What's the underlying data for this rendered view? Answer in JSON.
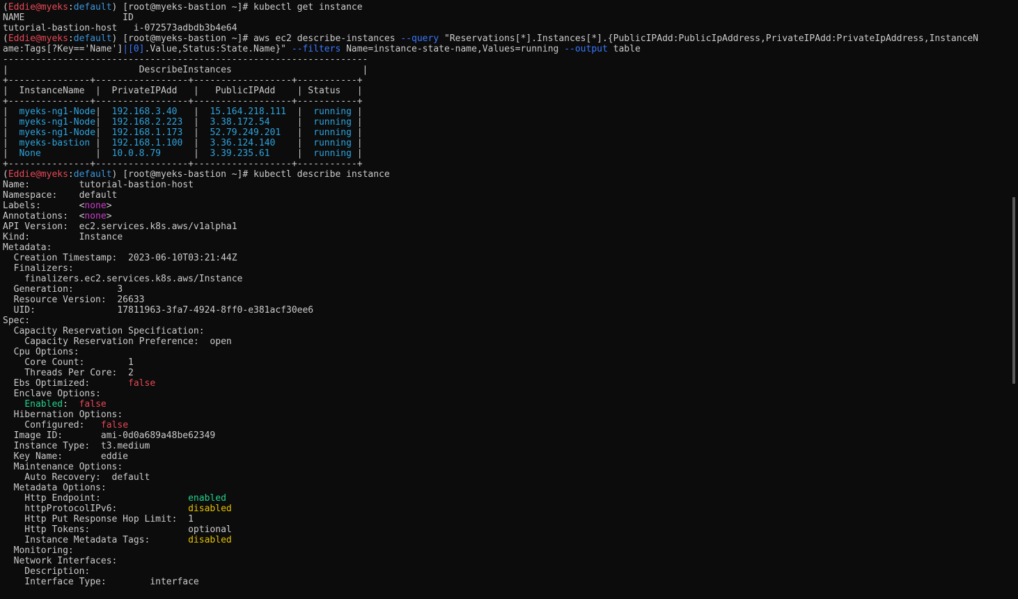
{
  "colors": {
    "background": "#0c0c0c",
    "text": "#cccccc",
    "prompt_user": "#e74856",
    "prompt_context": "#3a96dd",
    "option": "#3b78ff",
    "table_value": "#2ea3dd",
    "none_value": "#c83cc8",
    "enabled_value": "#23d18b",
    "disabled_value": "#e5c100",
    "false_value": "#e74856"
  },
  "lines": [
    [
      [
        "(",
        "w"
      ],
      [
        "Eddie@myeks",
        "r"
      ],
      [
        ":",
        "w"
      ],
      [
        "default",
        "c"
      ],
      [
        ") [root@myeks-bastion ~]# kubectl get instance",
        "w"
      ]
    ],
    [
      [
        "NAME                  ID",
        "w"
      ]
    ],
    [
      [
        "tutorial-bastion-host   i-072573adbdb3b4e64",
        "w"
      ]
    ],
    [
      [
        "(",
        "w"
      ],
      [
        "Eddie@myeks",
        "r"
      ],
      [
        ":",
        "w"
      ],
      [
        "default",
        "c"
      ],
      [
        ") [root@myeks-bastion ~]# aws ec2 describe-instances ",
        "w"
      ],
      [
        "--query",
        "b"
      ],
      [
        " \"Reservations[*].Instances[*].{PublicIPAdd:PublicIpAddress,PrivateIPAdd:PrivateIpAddress,InstanceN",
        "w"
      ]
    ],
    [
      [
        "ame:Tags[?Key=='Name']",
        "w"
      ],
      [
        "|[0]",
        "b"
      ],
      [
        ".Value,Status:State.Name}\" ",
        "w"
      ],
      [
        "--filters",
        "b"
      ],
      [
        " Name=instance-state-name,Values=running ",
        "w"
      ],
      [
        "--output",
        "b"
      ],
      [
        " table",
        "w"
      ]
    ],
    [
      [
        "-------------------------------------------------------------------",
        "w"
      ]
    ],
    [
      [
        "|                        DescribeInstances                        |",
        "w"
      ]
    ],
    [
      [
        "+---------------+-----------------+------------------+-----------+",
        "w"
      ]
    ],
    [
      [
        "|  InstanceName  |  PrivateIPAdd   |   PublicIPAdd    | Status   |",
        "w"
      ]
    ],
    [
      [
        "+---------------+-----------------+------------------+-----------+",
        "w"
      ]
    ],
    [
      [
        "|  ",
        "w"
      ],
      [
        "myeks-ng1-Node",
        "t"
      ],
      [
        "|  ",
        "w"
      ],
      [
        "192.168.3.40",
        "t"
      ],
      [
        "   |  ",
        "w"
      ],
      [
        "15.164.218.111",
        "t"
      ],
      [
        "  |  ",
        "w"
      ],
      [
        "running",
        "t"
      ],
      [
        " |",
        "w"
      ]
    ],
    [
      [
        "|  ",
        "w"
      ],
      [
        "myeks-ng1-Node",
        "t"
      ],
      [
        "|  ",
        "w"
      ],
      [
        "192.168.2.223",
        "t"
      ],
      [
        "  |  ",
        "w"
      ],
      [
        "3.38.172.54",
        "t"
      ],
      [
        "     |  ",
        "w"
      ],
      [
        "running",
        "t"
      ],
      [
        " |",
        "w"
      ]
    ],
    [
      [
        "|  ",
        "w"
      ],
      [
        "myeks-ng1-Node",
        "t"
      ],
      [
        "|  ",
        "w"
      ],
      [
        "192.168.1.173",
        "t"
      ],
      [
        "  |  ",
        "w"
      ],
      [
        "52.79.249.201",
        "t"
      ],
      [
        "   |  ",
        "w"
      ],
      [
        "running",
        "t"
      ],
      [
        " |",
        "w"
      ]
    ],
    [
      [
        "|  ",
        "w"
      ],
      [
        "myeks-bastion",
        "t"
      ],
      [
        " |  ",
        "w"
      ],
      [
        "192.168.1.100",
        "t"
      ],
      [
        "  |  ",
        "w"
      ],
      [
        "3.36.124.140",
        "t"
      ],
      [
        "    |  ",
        "w"
      ],
      [
        "running",
        "t"
      ],
      [
        " |",
        "w"
      ]
    ],
    [
      [
        "|  ",
        "w"
      ],
      [
        "None",
        "t"
      ],
      [
        "          |  ",
        "w"
      ],
      [
        "10.0.8.79",
        "t"
      ],
      [
        "      |  ",
        "w"
      ],
      [
        "3.39.235.61",
        "t"
      ],
      [
        "     |  ",
        "w"
      ],
      [
        "running",
        "t"
      ],
      [
        " |",
        "w"
      ]
    ],
    [
      [
        "+---------------+-----------------+------------------+-----------+",
        "w"
      ]
    ],
    [
      [
        "(",
        "w"
      ],
      [
        "Eddie@myeks",
        "r"
      ],
      [
        ":",
        "w"
      ],
      [
        "default",
        "c"
      ],
      [
        ") [root@myeks-bastion ~]# kubectl describe instance",
        "w"
      ]
    ],
    [
      [
        "Name:         tutorial-bastion-host",
        "w"
      ]
    ],
    [
      [
        "Namespace:    default",
        "w"
      ]
    ],
    [
      [
        "Labels:       <",
        "w"
      ],
      [
        "none",
        "m"
      ],
      [
        ">",
        "w"
      ]
    ],
    [
      [
        "Annotations:  <",
        "w"
      ],
      [
        "none",
        "m"
      ],
      [
        ">",
        "w"
      ]
    ],
    [
      [
        "API Version:  ec2.services.k8s.aws/v1alpha1",
        "w"
      ]
    ],
    [
      [
        "Kind:         Instance",
        "w"
      ]
    ],
    [
      [
        "Metadata:",
        "w"
      ]
    ],
    [
      [
        "  Creation Timestamp:  2023-06-10T03:21:44Z",
        "w"
      ]
    ],
    [
      [
        "  Finalizers:",
        "w"
      ]
    ],
    [
      [
        "    finalizers.ec2.services.k8s.aws/Instance",
        "w"
      ]
    ],
    [
      [
        "  Generation:        3",
        "w"
      ]
    ],
    [
      [
        "  Resource Version:  26633",
        "w"
      ]
    ],
    [
      [
        "  UID:               17811963-3fa7-4924-8ff0-e381acf30ee6",
        "w"
      ]
    ],
    [
      [
        "Spec:",
        "w"
      ]
    ],
    [
      [
        "  Capacity Reservation Specification:",
        "w"
      ]
    ],
    [
      [
        "    Capacity Reservation Preference:  open",
        "w"
      ]
    ],
    [
      [
        "  Cpu Options:",
        "w"
      ]
    ],
    [
      [
        "    Core Count:        1",
        "w"
      ]
    ],
    [
      [
        "    Threads Per Core:  2",
        "w"
      ]
    ],
    [
      [
        "  Ebs Optimized:       ",
        "w"
      ],
      [
        "false",
        "f"
      ]
    ],
    [
      [
        "  Enclave Options:",
        "w"
      ]
    ],
    [
      [
        "    ",
        "w"
      ],
      [
        "Enabled",
        "g"
      ],
      [
        ":  ",
        "w"
      ],
      [
        "false",
        "f"
      ]
    ],
    [
      [
        "  Hibernation Options:",
        "w"
      ]
    ],
    [
      [
        "    Configured:   ",
        "w"
      ],
      [
        "false",
        "f"
      ]
    ],
    [
      [
        "  Image ID:       ami-0d0a689a48be62349",
        "w"
      ]
    ],
    [
      [
        "  Instance Type:  t3.medium",
        "w"
      ]
    ],
    [
      [
        "  Key Name:       eddie",
        "w"
      ]
    ],
    [
      [
        "  Maintenance Options:",
        "w"
      ]
    ],
    [
      [
        "    Auto Recovery:  default",
        "w"
      ]
    ],
    [
      [
        "  Metadata Options:",
        "w"
      ]
    ],
    [
      [
        "    Http Endpoint:                ",
        "w"
      ],
      [
        "enabled",
        "g"
      ]
    ],
    [
      [
        "    httpProtocolIPv6:             ",
        "w"
      ],
      [
        "disabled",
        "y"
      ]
    ],
    [
      [
        "    Http Put Response Hop Limit:  1",
        "w"
      ]
    ],
    [
      [
        "    Http Tokens:                  optional",
        "w"
      ]
    ],
    [
      [
        "    Instance Metadata Tags:       ",
        "w"
      ],
      [
        "disabled",
        "y"
      ]
    ],
    [
      [
        "  Monitoring:",
        "w"
      ]
    ],
    [
      [
        "  Network Interfaces:",
        "w"
      ]
    ],
    [
      [
        "    Description:",
        "w"
      ]
    ],
    [
      [
        "    Interface Type:        interface",
        "w"
      ]
    ]
  ]
}
